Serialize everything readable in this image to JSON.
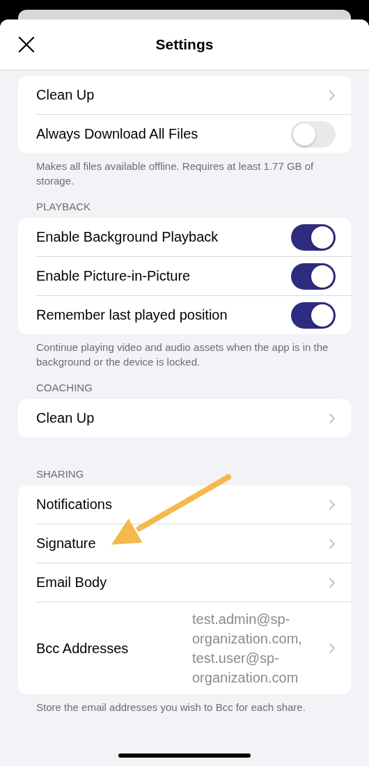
{
  "header": {
    "title": "Settings"
  },
  "sections": [
    {
      "rows": [
        {
          "kind": "link",
          "label": "Clean Up"
        },
        {
          "kind": "toggle",
          "label": "Always Download All Files",
          "on": false
        }
      ],
      "footer": "Makes all files available offline. Requires at least 1.77 GB of storage."
    },
    {
      "title": "PLAYBACK",
      "rows": [
        {
          "kind": "toggle",
          "label": "Enable Background Playback",
          "on": true
        },
        {
          "kind": "toggle",
          "label": "Enable Picture-in-Picture",
          "on": true
        },
        {
          "kind": "toggle",
          "label": "Remember last played position",
          "on": true
        }
      ],
      "footer": "Continue playing video and audio assets when the app is in the background or the device is locked."
    },
    {
      "title": "COACHING",
      "rows": [
        {
          "kind": "link",
          "label": "Clean Up"
        }
      ]
    },
    {
      "title": "SHARING",
      "rows": [
        {
          "kind": "link",
          "label": "Notifications"
        },
        {
          "kind": "link",
          "label": "Signature"
        },
        {
          "kind": "link",
          "label": "Email Body"
        },
        {
          "kind": "link",
          "label": "Bcc Addresses",
          "value": "test.admin@sp-organization.com, test.user@sp-organization.com"
        }
      ],
      "footer": "Store the email addresses you wish to Bcc for each share."
    }
  ]
}
